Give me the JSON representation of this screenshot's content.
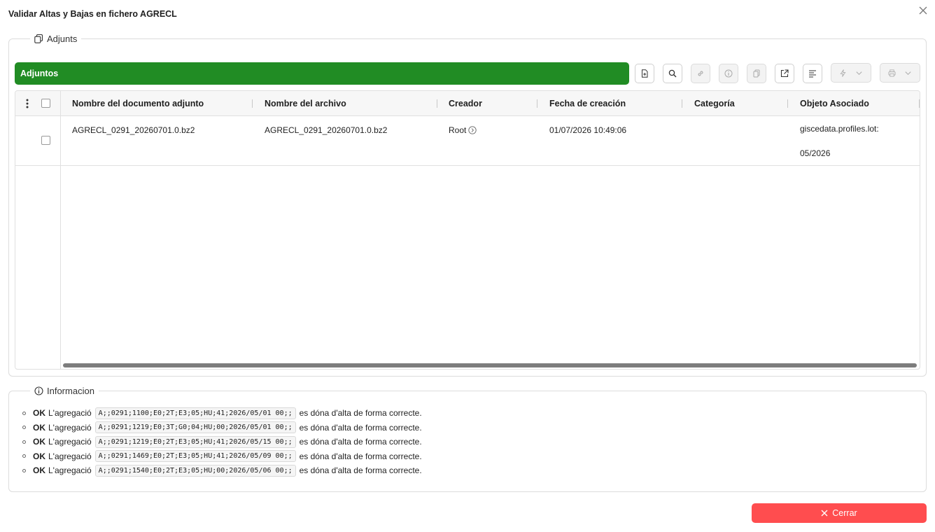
{
  "dialog": {
    "title": "Validar Altas y Bajas en fichero AGRECL"
  },
  "adjunts_group": {
    "legend": "Adjunts",
    "bar_title": "Adjuntos"
  },
  "toolbar": {
    "icons": [
      "new-document-icon",
      "search-icon",
      "link-icon",
      "info-icon",
      "copy-icon",
      "open-external-icon",
      "align-left-icon",
      "lightning-icon",
      "printer-icon"
    ]
  },
  "table": {
    "columns": [
      "Nombre del documento adjunto",
      "Nombre del archivo",
      "Creador",
      "Fecha de creación",
      "Categoría",
      "Objeto Asociado"
    ],
    "rows": [
      {
        "document_name": "AGRECL_0291_20260701.0.bz2",
        "file_name": "AGRECL_0291_20260701.0.bz2",
        "creator": "Root",
        "created": "01/07/2026 10:49:06",
        "category": "",
        "object_line1": "giscedata.profiles.lot:",
        "object_line2": "05/2026"
      }
    ]
  },
  "info_group": {
    "legend": "Informacion",
    "items": [
      {
        "status": "OK",
        "prefix": "L'agregació",
        "code": "A;;0291;1100;E0;2T;E3;05;HU;41;2026/05/01 00;;",
        "suffix": "es dóna d'alta de forma correcte."
      },
      {
        "status": "OK",
        "prefix": "L'agregació",
        "code": "A;;0291;1219;E0;3T;G0;04;HU;00;2026/05/01 00;;",
        "suffix": "es dóna d'alta de forma correcte."
      },
      {
        "status": "OK",
        "prefix": "L'agregació",
        "code": "A;;0291;1219;E0;2T;E3;05;HU;41;2026/05/15 00;;",
        "suffix": "es dóna d'alta de forma correcte."
      },
      {
        "status": "OK",
        "prefix": "L'agregació",
        "code": "A;;0291;1469;E0;2T;E3;05;HU;41;2026/05/09 00;;",
        "suffix": "es dóna d'alta de forma correcte."
      },
      {
        "status": "OK",
        "prefix": "L'agregació",
        "code": "A;;0291;1540;E0;2T;E3;05;HU;00;2026/05/06 00;;",
        "suffix": "es dóna d'alta de forma correcte."
      }
    ]
  },
  "footer": {
    "close_label": "Cerrar"
  },
  "colors": {
    "bar_green": "#218c24",
    "close_red": "#ff4d4f"
  }
}
